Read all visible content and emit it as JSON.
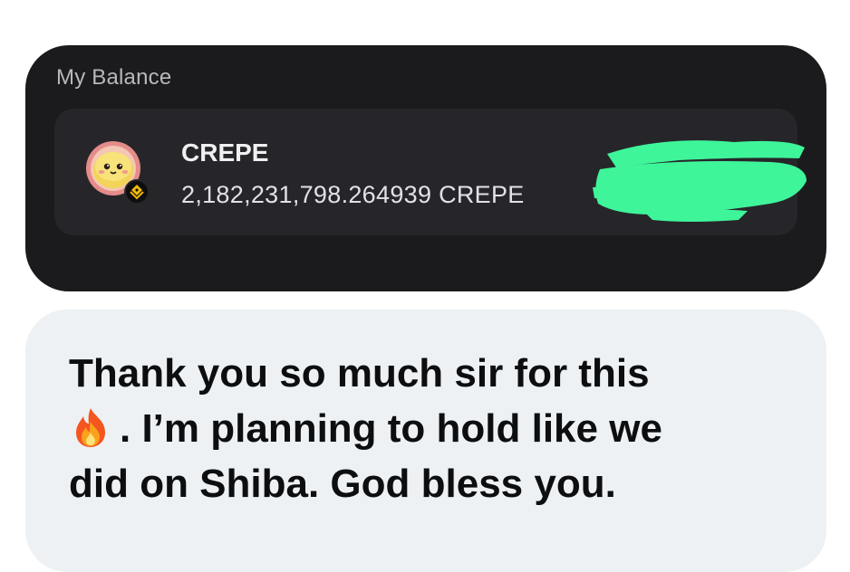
{
  "balance": {
    "title": "My Balance",
    "token": {
      "name": "CREPE",
      "amount": "2,182,231,798.264939 CREPE",
      "avatar_icon": "crepe-mascot-icon",
      "chain_badge_icon": "bnb-chain-icon"
    },
    "redaction_color": "#3ff59a"
  },
  "message": {
    "text_before_emoji": "",
    "emoji": "fire-emoji-icon",
    "line_1": "Thank you so much sir for this",
    "line_2_after_emoji": ". I’m planning to hold like we",
    "line_3": "did on Shiba. God bless you."
  },
  "colors": {
    "card_background": "#1b1b1d",
    "row_background": "#26262a",
    "bubble_background": "#eef1f3"
  }
}
